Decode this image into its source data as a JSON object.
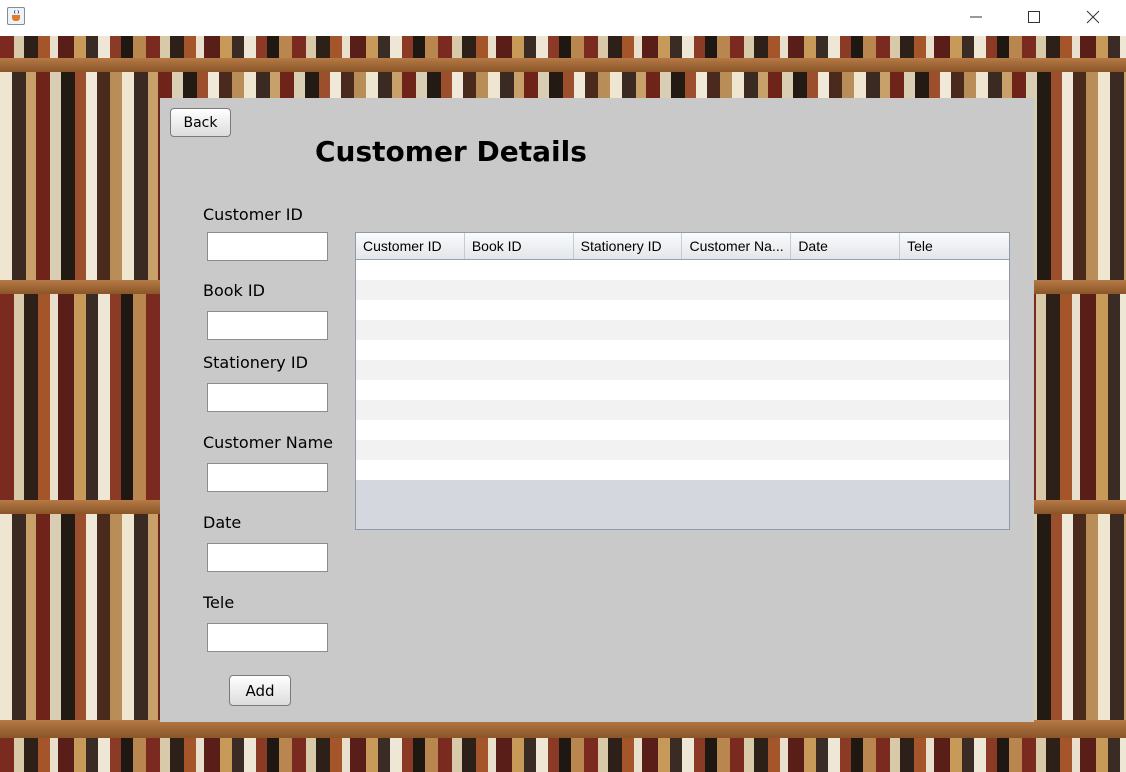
{
  "window": {
    "minimize_icon": "minimize-icon",
    "maximize_icon": "maximize-icon",
    "close_icon": "close-icon"
  },
  "page": {
    "title": "Customer Details",
    "back_label": "Back",
    "add_label": "Add"
  },
  "form": {
    "fields": [
      {
        "label": "Customer ID",
        "value": ""
      },
      {
        "label": "Book ID",
        "value": ""
      },
      {
        "label": "Stationery ID",
        "value": ""
      },
      {
        "label": "Customer Name",
        "value": ""
      },
      {
        "label": "Date",
        "value": ""
      },
      {
        "label": "Tele",
        "value": ""
      }
    ]
  },
  "table": {
    "columns": [
      "Customer ID",
      "Book ID",
      "Stationery ID",
      "Customer Na...",
      "Date",
      "Tele"
    ],
    "rows": []
  }
}
